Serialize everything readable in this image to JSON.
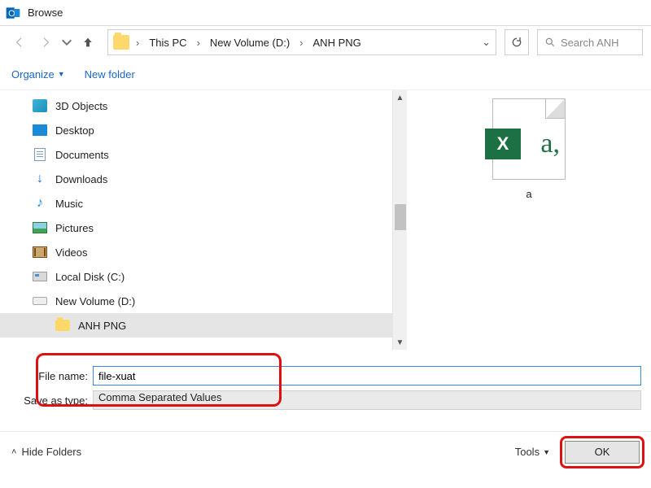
{
  "window": {
    "title": "Browse"
  },
  "breadcrumb": {
    "segments": [
      "This PC",
      "New Volume (D:)",
      "ANH PNG"
    ]
  },
  "search": {
    "placeholder": "Search ANH"
  },
  "toolbar": {
    "organize": "Organize",
    "new_folder": "New folder"
  },
  "tree": {
    "items": [
      {
        "label": "3D Objects"
      },
      {
        "label": "Desktop"
      },
      {
        "label": "Documents"
      },
      {
        "label": "Downloads"
      },
      {
        "label": "Music"
      },
      {
        "label": "Pictures"
      },
      {
        "label": "Videos"
      },
      {
        "label": "Local Disk (C:)"
      },
      {
        "label": "New Volume (D:)"
      }
    ],
    "child": {
      "label": "ANH PNG"
    }
  },
  "preview": {
    "file_label": "a"
  },
  "form": {
    "file_name_label": "File name:",
    "file_name_value": "file-xuat",
    "save_type_label": "Save as type:",
    "save_type_value": "Comma Separated Values"
  },
  "footer": {
    "hide_folders": "Hide Folders",
    "tools": "Tools",
    "ok": "OK"
  }
}
